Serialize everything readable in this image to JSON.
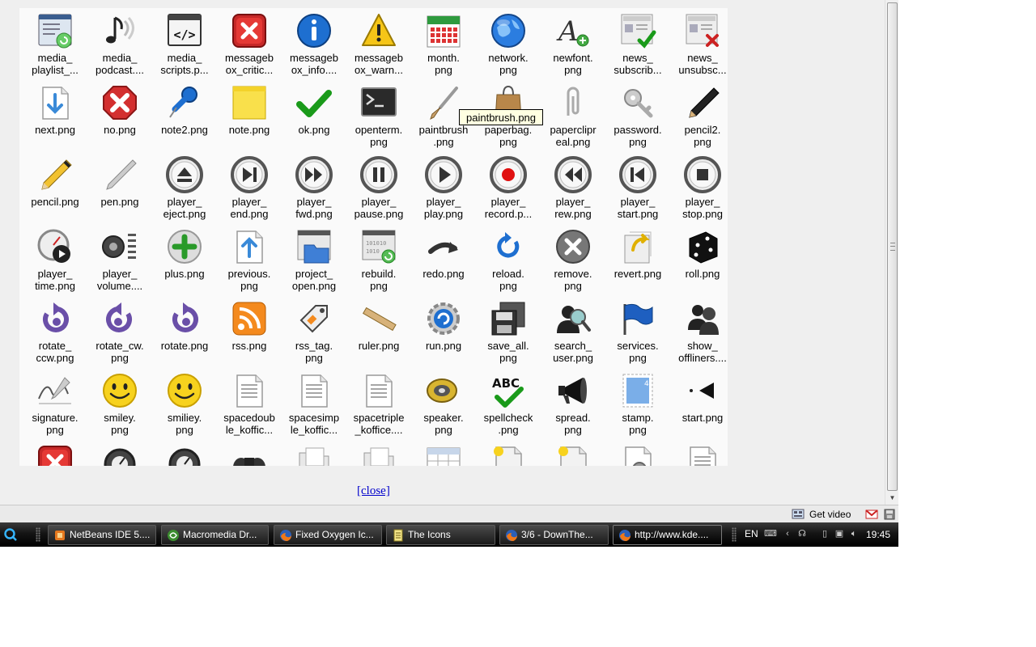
{
  "icons": [
    {
      "label": "media_\nplaylist_...",
      "icon": "media-playlist-icon"
    },
    {
      "label": "media_\npodcast....",
      "icon": "music-note-icon"
    },
    {
      "label": "media_\nscripts.p...",
      "icon": "code-window-icon"
    },
    {
      "label": "messageb\nox_critic...",
      "icon": "critical-x-icon"
    },
    {
      "label": "messageb\nox_info....",
      "icon": "info-icon"
    },
    {
      "label": "messageb\nox_warn...",
      "icon": "warning-icon"
    },
    {
      "label": "month.\npng",
      "icon": "calendar-icon"
    },
    {
      "label": "network.\npng",
      "icon": "globe-icon"
    },
    {
      "label": "newfont.\npng",
      "icon": "new-font-icon"
    },
    {
      "label": "news_\nsubscrib...",
      "icon": "news-subscribe-icon"
    },
    {
      "label": "news_\nunsubsc...",
      "icon": "news-unsubscribe-icon"
    },
    {
      "label": "next.png",
      "icon": "next-doc-icon"
    },
    {
      "label": "no.png",
      "icon": "no-icon"
    },
    {
      "label": "note2.png",
      "icon": "pushpin-icon"
    },
    {
      "label": "note.png",
      "icon": "sticky-note-icon"
    },
    {
      "label": "ok.png",
      "icon": "checkmark-icon"
    },
    {
      "label": "openterm.\npng",
      "icon": "terminal-icon"
    },
    {
      "label": "paintbrush\n.png",
      "icon": "paintbrush-icon"
    },
    {
      "label": "paperbag.\npng",
      "icon": "paperbag-icon"
    },
    {
      "label": "paperclipr\neal.png",
      "icon": "paperclip-icon"
    },
    {
      "label": "password.\npng",
      "icon": "keys-icon"
    },
    {
      "label": "pencil2.\npng",
      "icon": "pencil-black-icon"
    },
    {
      "label": "pencil.png",
      "icon": "pencil-icon"
    },
    {
      "label": "pen.png",
      "icon": "pen-icon"
    },
    {
      "label": "player_\neject.png",
      "icon": "player-eject-icon"
    },
    {
      "label": "player_\nend.png",
      "icon": "player-end-icon"
    },
    {
      "label": "player_\nfwd.png",
      "icon": "player-fwd-icon"
    },
    {
      "label": "player_\npause.png",
      "icon": "player-pause-icon"
    },
    {
      "label": "player_\nplay.png",
      "icon": "player-play-icon"
    },
    {
      "label": "player_\nrecord.p...",
      "icon": "player-record-icon"
    },
    {
      "label": "player_\nrew.png",
      "icon": "player-rew-icon"
    },
    {
      "label": "player_\nstart.png",
      "icon": "player-start-icon"
    },
    {
      "label": "player_\nstop.png",
      "icon": "player-stop-icon"
    },
    {
      "label": "player_\ntime.png",
      "icon": "player-time-icon"
    },
    {
      "label": "player_\nvolume....",
      "icon": "player-volume-icon"
    },
    {
      "label": "plus.png",
      "icon": "plus-icon"
    },
    {
      "label": "previous.\npng",
      "icon": "previous-doc-icon"
    },
    {
      "label": "project_\nopen.png",
      "icon": "project-open-icon"
    },
    {
      "label": "rebuild.\npng",
      "icon": "rebuild-icon"
    },
    {
      "label": "redo.png",
      "icon": "redo-icon"
    },
    {
      "label": "reload.\npng",
      "icon": "reload-icon"
    },
    {
      "label": "remove.\npng",
      "icon": "remove-icon"
    },
    {
      "label": "revert.png",
      "icon": "revert-icon"
    },
    {
      "label": "roll.png",
      "icon": "dice-icon"
    },
    {
      "label": "rotate_\nccw.png",
      "icon": "rotate-ccw-icon"
    },
    {
      "label": "rotate_cw.\npng",
      "icon": "rotate-cw-icon"
    },
    {
      "label": "rotate.png",
      "icon": "rotate-icon"
    },
    {
      "label": "rss.png",
      "icon": "rss-icon"
    },
    {
      "label": "rss_tag.\npng",
      "icon": "rss-tag-icon"
    },
    {
      "label": "ruler.png",
      "icon": "ruler-icon"
    },
    {
      "label": "run.png",
      "icon": "run-gear-icon"
    },
    {
      "label": "save_all.\npng",
      "icon": "save-all-icon"
    },
    {
      "label": "search_\nuser.png",
      "icon": "search-user-icon"
    },
    {
      "label": "services.\npng",
      "icon": "flag-icon"
    },
    {
      "label": "show_\noffliners....",
      "icon": "show-offliners-icon"
    },
    {
      "label": "signature.\npng",
      "icon": "signature-icon"
    },
    {
      "label": "smiley.\npng",
      "icon": "smiley-icon"
    },
    {
      "label": "smiliey.\npng",
      "icon": "smiley-icon"
    },
    {
      "label": "spacedoub\nle_koffic...",
      "icon": "document-lines-icon"
    },
    {
      "label": "spacesimp\nle_koffic...",
      "icon": "document-lines-icon"
    },
    {
      "label": "spacetriple\n_koffice....",
      "icon": "document-lines-icon"
    },
    {
      "label": "speaker.\npng",
      "icon": "speaker-icon"
    },
    {
      "label": "spellcheck\n.png",
      "icon": "spellcheck-icon"
    },
    {
      "label": "spread.\npng",
      "icon": "megaphone-icon"
    },
    {
      "label": "stamp.\npng",
      "icon": "stamp-icon"
    },
    {
      "label": "start.png",
      "icon": "start-arrow-icon"
    },
    {
      "label": "",
      "icon": "critical-x-icon"
    },
    {
      "label": "",
      "icon": "stopwatch-icon"
    },
    {
      "label": "",
      "icon": "stopwatch-icon"
    },
    {
      "label": "",
      "icon": "binoculars-icon"
    },
    {
      "label": "",
      "icon": "folder-doc-icon"
    },
    {
      "label": "",
      "icon": "folder-doc-icon"
    },
    {
      "label": "",
      "icon": "table-icon"
    },
    {
      "label": "",
      "icon": "new-doc-icon"
    },
    {
      "label": "",
      "icon": "new-doc-icon"
    },
    {
      "label": "",
      "icon": "settings-doc-icon"
    },
    {
      "label": "",
      "icon": "document-lines-icon"
    }
  ],
  "tooltip": "paintbrush.png",
  "close_link": "[close]",
  "statusbar": {
    "get_video": "Get video"
  },
  "taskbar": {
    "buttons": [
      {
        "label": "NetBeans IDE 5....",
        "icon": "netbeans-icon",
        "active": false
      },
      {
        "label": "Macromedia Dr...",
        "icon": "dreamweaver-icon",
        "active": false
      },
      {
        "label": "Fixed Oxygen Ic...",
        "icon": "firefox-icon",
        "active": false
      },
      {
        "label": "The Icons",
        "icon": "notepad-icon",
        "active": false
      },
      {
        "label": "3/6 - DownThe...",
        "icon": "firefox-icon",
        "active": false
      },
      {
        "label": "http://www.kde....",
        "icon": "firefox-icon",
        "active": true
      }
    ],
    "language": "EN",
    "clock": "19:45"
  }
}
